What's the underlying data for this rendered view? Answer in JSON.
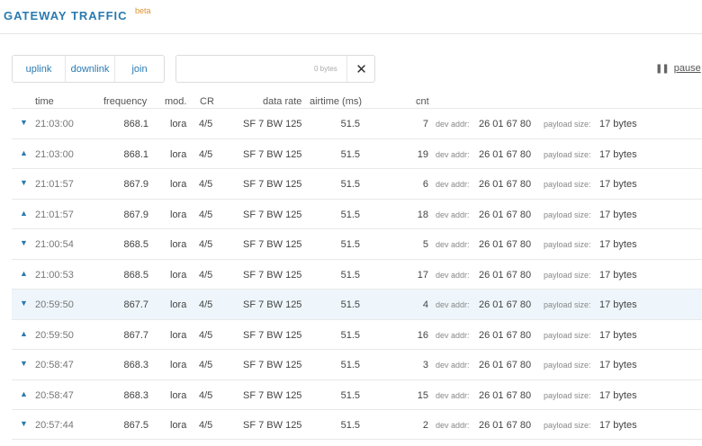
{
  "header": {
    "title": "GATEWAY TRAFFIC",
    "badge": "beta"
  },
  "filters": {
    "uplink": "uplink",
    "downlink": "downlink",
    "join": "join"
  },
  "search": {
    "value": "",
    "placeholder": "",
    "bytes_label": "0 bytes",
    "clear_icon": "close-icon"
  },
  "pause": {
    "label": "pause",
    "icon": "pause-icon"
  },
  "columns": {
    "time": "time",
    "frequency": "frequency",
    "mod": "mod.",
    "cr": "CR",
    "datarate": "data rate",
    "airtime": "airtime (ms)",
    "cnt": "cnt"
  },
  "row_labels": {
    "dev_addr": "dev addr:",
    "payload_size": "payload size:"
  },
  "colors": {
    "accent": "#2a7ab0",
    "beta": "#e0922f",
    "highlight": "#eef6fb"
  },
  "rows": [
    {
      "dir": "down",
      "arrow": "▼",
      "time": "21:03:00",
      "freq": "868.1",
      "mod": "lora",
      "cr": "4/5",
      "sf": "SF 7",
      "bw": "BW 125",
      "airtime": "51.5",
      "cnt": "7",
      "dev_addr": "26 01 67 80",
      "payload": "17 bytes"
    },
    {
      "dir": "up",
      "arrow": "▲",
      "time": "21:03:00",
      "freq": "868.1",
      "mod": "lora",
      "cr": "4/5",
      "sf": "SF 7",
      "bw": "BW 125",
      "airtime": "51.5",
      "cnt": "19",
      "dev_addr": "26 01 67 80",
      "payload": "17 bytes"
    },
    {
      "dir": "down",
      "arrow": "▼",
      "time": "21:01:57",
      "freq": "867.9",
      "mod": "lora",
      "cr": "4/5",
      "sf": "SF 7",
      "bw": "BW 125",
      "airtime": "51.5",
      "cnt": "6",
      "dev_addr": "26 01 67 80",
      "payload": "17 bytes"
    },
    {
      "dir": "up",
      "arrow": "▲",
      "time": "21:01:57",
      "freq": "867.9",
      "mod": "lora",
      "cr": "4/5",
      "sf": "SF 7",
      "bw": "BW 125",
      "airtime": "51.5",
      "cnt": "18",
      "dev_addr": "26 01 67 80",
      "payload": "17 bytes"
    },
    {
      "dir": "down",
      "arrow": "▼",
      "time": "21:00:54",
      "freq": "868.5",
      "mod": "lora",
      "cr": "4/5",
      "sf": "SF 7",
      "bw": "BW 125",
      "airtime": "51.5",
      "cnt": "5",
      "dev_addr": "26 01 67 80",
      "payload": "17 bytes"
    },
    {
      "dir": "up",
      "arrow": "▲",
      "time": "21:00:53",
      "freq": "868.5",
      "mod": "lora",
      "cr": "4/5",
      "sf": "SF 7",
      "bw": "BW 125",
      "airtime": "51.5",
      "cnt": "17",
      "dev_addr": "26 01 67 80",
      "payload": "17 bytes"
    },
    {
      "dir": "down",
      "arrow": "▼",
      "time": "20:59:50",
      "freq": "867.7",
      "mod": "lora",
      "cr": "4/5",
      "sf": "SF 7",
      "bw": "BW 125",
      "airtime": "51.5",
      "cnt": "4",
      "dev_addr": "26 01 67 80",
      "payload": "17 bytes",
      "highlight": true
    },
    {
      "dir": "up",
      "arrow": "▲",
      "time": "20:59:50",
      "freq": "867.7",
      "mod": "lora",
      "cr": "4/5",
      "sf": "SF 7",
      "bw": "BW 125",
      "airtime": "51.5",
      "cnt": "16",
      "dev_addr": "26 01 67 80",
      "payload": "17 bytes"
    },
    {
      "dir": "down",
      "arrow": "▼",
      "time": "20:58:47",
      "freq": "868.3",
      "mod": "lora",
      "cr": "4/5",
      "sf": "SF 7",
      "bw": "BW 125",
      "airtime": "51.5",
      "cnt": "3",
      "dev_addr": "26 01 67 80",
      "payload": "17 bytes"
    },
    {
      "dir": "up",
      "arrow": "▲",
      "time": "20:58:47",
      "freq": "868.3",
      "mod": "lora",
      "cr": "4/5",
      "sf": "SF 7",
      "bw": "BW 125",
      "airtime": "51.5",
      "cnt": "15",
      "dev_addr": "26 01 67 80",
      "payload": "17 bytes"
    },
    {
      "dir": "down",
      "arrow": "▼",
      "time": "20:57:44",
      "freq": "867.5",
      "mod": "lora",
      "cr": "4/5",
      "sf": "SF 7",
      "bw": "BW 125",
      "airtime": "51.5",
      "cnt": "2",
      "dev_addr": "26 01 67 80",
      "payload": "17 bytes"
    }
  ]
}
